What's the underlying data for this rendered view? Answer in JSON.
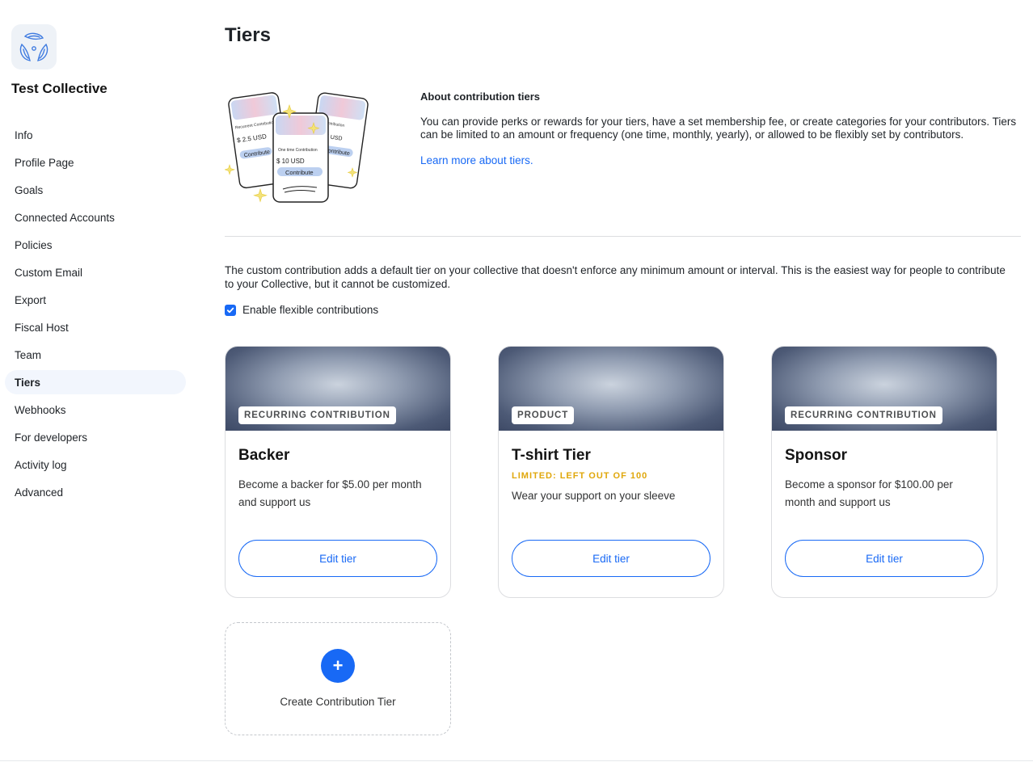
{
  "sidebar": {
    "collective_name": "Test Collective",
    "items": [
      {
        "label": "Info",
        "active": false
      },
      {
        "label": "Profile Page",
        "active": false
      },
      {
        "label": "Goals",
        "active": false
      },
      {
        "label": "Connected Accounts",
        "active": false
      },
      {
        "label": "Policies",
        "active": false
      },
      {
        "label": "Custom Email",
        "active": false
      },
      {
        "label": "Export",
        "active": false
      },
      {
        "label": "Fiscal Host",
        "active": false
      },
      {
        "label": "Team",
        "active": false
      },
      {
        "label": "Tiers",
        "active": true
      },
      {
        "label": "Webhooks",
        "active": false
      },
      {
        "label": "For developers",
        "active": false
      },
      {
        "label": "Activity log",
        "active": false
      },
      {
        "label": "Advanced",
        "active": false
      }
    ]
  },
  "main": {
    "title": "Tiers",
    "about": {
      "title": "About contribution tiers",
      "text": "You can provide perks or rewards for your tiers, have a set membership fee, or create categories for your contributors. Tiers can be limited to an amount or frequency (one time, monthly, yearly), or allowed to be flexibly set by contributors.",
      "link": "Learn more about tiers."
    },
    "illustration": {
      "card_left": {
        "title": "Recurrent Contribution",
        "amount": "$ 2.5 USD",
        "button": "Contribute"
      },
      "card_center": {
        "title": "One time Contribution",
        "amount": "$ 10 USD",
        "button": "Contribute"
      },
      "card_right": {
        "title": "Contribution",
        "amount": "$ 5 USD",
        "button": "Contribute"
      }
    },
    "custom_contribution": {
      "description": "The custom contribution adds a default tier on your collective that doesn't enforce any minimum amount or interval. This is the easiest way for people to contribute to your Collective, but it cannot be customized.",
      "checkbox_label": "Enable flexible contributions",
      "checked": true
    },
    "tiers": [
      {
        "type": "RECURRING CONTRIBUTION",
        "name": "Backer",
        "limit": "",
        "description": "Become a backer for $5.00 per month and support us",
        "button": "Edit tier"
      },
      {
        "type": "PRODUCT",
        "name": "T-shirt Tier",
        "limit": "LIMITED: LEFT OUT OF 100",
        "description": "Wear your support on your sleeve",
        "button": "Edit tier"
      },
      {
        "type": "RECURRING CONTRIBUTION",
        "name": "Sponsor",
        "limit": "",
        "description": "Become a sponsor for $100.00 per month and support us",
        "button": "Edit tier"
      }
    ],
    "create_tier": {
      "icon": "plus-icon",
      "label": "Create Contribution Tier"
    }
  },
  "colors": {
    "accent": "#1869f5",
    "limit": "#e0a70b",
    "active_nav_bg": "#f2f6fd"
  }
}
